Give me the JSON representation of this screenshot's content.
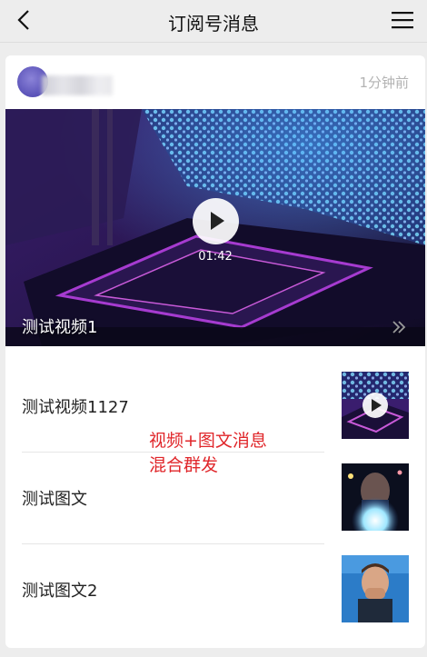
{
  "nav": {
    "title": "订阅号消息"
  },
  "card": {
    "time": "1分钟前",
    "hero": {
      "duration": "01:42",
      "title": "测试视频1"
    },
    "items": [
      {
        "title": "测试视频1127"
      },
      {
        "title": "测试图文"
      },
      {
        "title": "测试图文2"
      }
    ]
  },
  "annotation": {
    "line1": "视频+图文消息",
    "line2": "混合群发"
  },
  "colors": {
    "annotation": "#e0262a",
    "background": "#ededed"
  }
}
